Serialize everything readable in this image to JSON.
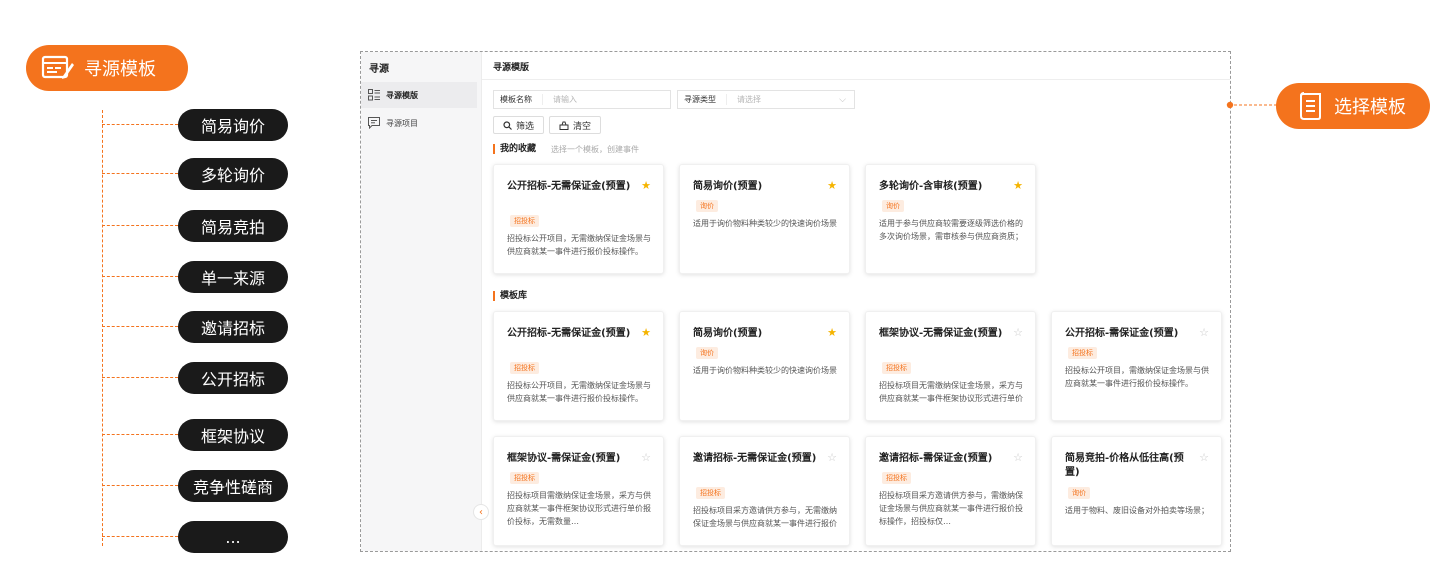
{
  "left_callout": {
    "label": "寻源模板",
    "icon": "template-edit-icon"
  },
  "right_callout": {
    "label": "选择模板",
    "icon": "scroll-document-icon"
  },
  "tree_items": [
    "简易询价",
    "多轮询价",
    "简易竞拍",
    "单一来源",
    "邀请招标",
    "公开招标",
    "框架协议",
    "竞争性磋商",
    "..."
  ],
  "app": {
    "sidebar": {
      "title": "寻源",
      "items": [
        {
          "label": "寻源模版",
          "icon": "grid-list-icon",
          "active": true
        },
        {
          "label": "寻源项目",
          "icon": "message-icon",
          "active": false
        }
      ]
    },
    "main_title": "寻源模版",
    "filters": {
      "name_label": "模板名称",
      "name_placeholder": "请输入",
      "type_label": "寻源类型",
      "type_placeholder": "请选择"
    },
    "buttons": {
      "search": "筛选",
      "clear": "清空"
    },
    "favorites": {
      "title": "我的收藏",
      "hint": "选择一个模板，创建事件",
      "cards": [
        {
          "title": "公开招标-无需保证金(预置)",
          "tag": "招投标",
          "starred": true,
          "desc": "招投标公开项目，无需缴纳保证金场景与供应商就某一事件进行报价投标操作。"
        },
        {
          "title": "简易询价(预置)",
          "tag": "询价",
          "starred": true,
          "desc": "适用于询价物料种类较少的快速询价场景"
        },
        {
          "title": "多轮询价-含审核(预置)",
          "tag": "询价",
          "starred": true,
          "desc": "适用于参与供应商较需要逐级筛选价格的多次询价场景，需审核参与供应商资质；"
        }
      ]
    },
    "library": {
      "title": "模板库",
      "cards": [
        {
          "title": "公开招标-无需保证金(预置)",
          "tag": "招投标",
          "starred": true,
          "desc": "招投标公开项目，无需缴纳保证金场景与供应商就某一事件进行报价投标操作。"
        },
        {
          "title": "简易询价(预置)",
          "tag": "询价",
          "starred": true,
          "desc": "适用于询价物料种类较少的快速询价场景"
        },
        {
          "title": "框架协议-无需保证金(预置)",
          "tag": "招投标",
          "starred": false,
          "desc": "招投标项目无需缴纳保证金场景，采方与供应商就某一事件框架协议形式进行单价报价投标，无需数…"
        },
        {
          "title": "公开招标-需保证金(预置)",
          "tag": "招投标",
          "starred": false,
          "desc": "招投标公开项目，需缴纳保证金场景与供应商就某一事件进行报价投标操作。"
        },
        {
          "title": "框架协议-需保证金(预置)",
          "tag": "招投标",
          "starred": false,
          "desc": "招投标项目需缴纳保证金场景，采方与供应商就某一事件框架协议形式进行单价报价投标，无需数量…"
        },
        {
          "title": "邀请招标-无需保证金(预置)",
          "tag": "招投标",
          "starred": false,
          "desc": "招投标项目采方邀请供方参与，无需缴纳保证金场景与供应商就某一事件进行报价投标操作，招投标…"
        },
        {
          "title": "邀请招标-需保证金(预置)",
          "tag": "招投标",
          "starred": false,
          "desc": "招投标项目采方邀请供方参与，需缴纳保证金场景与供应商就某一事件进行报价投标操作，招投标仅…"
        },
        {
          "title": "简易竞拍-价格从低往高(预置)",
          "tag": "询价",
          "starred": false,
          "desc": "适用于物料、废旧设备对外拍卖等场景；"
        }
      ]
    },
    "colors": {
      "accent": "#f4731d",
      "star_on": "#f5b400",
      "tag_bg": "#fdece0"
    }
  }
}
